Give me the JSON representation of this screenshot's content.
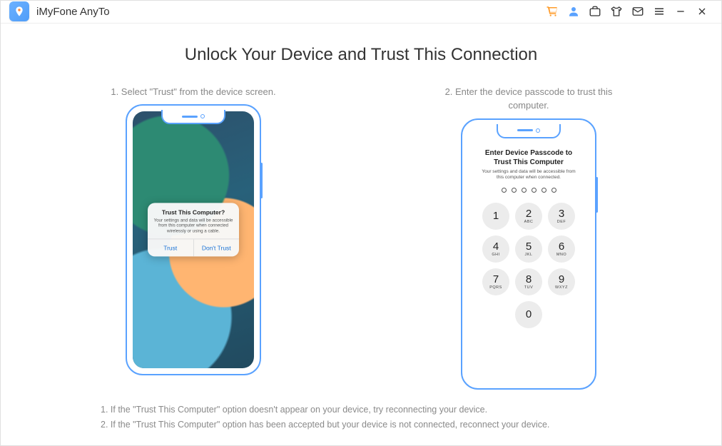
{
  "app": {
    "title": "iMyFone AnyTo"
  },
  "main": {
    "title": "Unlock Your Device and Trust This Connection",
    "steps": {
      "left": {
        "caption": "1. Select \"Trust\" from the device screen."
      },
      "right": {
        "caption": "2. Enter the device passcode to trust this computer."
      }
    }
  },
  "trust_dialog": {
    "title": "Trust This Computer?",
    "body": "Your settings and data will be accessible from this computer when connected wirelessly or using a cable.",
    "trust": "Trust",
    "dont_trust": "Don't Trust"
  },
  "passcode": {
    "title": "Enter Device Passcode to Trust This Computer",
    "sub": "Your settings and data will be accessible from this computer when connected.",
    "keys": [
      {
        "n": "1",
        "l": ""
      },
      {
        "n": "2",
        "l": "ABC"
      },
      {
        "n": "3",
        "l": "DEF"
      },
      {
        "n": "4",
        "l": "GHI"
      },
      {
        "n": "5",
        "l": "JKL"
      },
      {
        "n": "6",
        "l": "MNO"
      },
      {
        "n": "7",
        "l": "PQRS"
      },
      {
        "n": "8",
        "l": "TUV"
      },
      {
        "n": "9",
        "l": "WXYZ"
      },
      {
        "n": "0",
        "l": ""
      }
    ]
  },
  "notes": {
    "n1": "1. If the \"Trust This Computer\" option doesn't appear on your device, try reconnecting your device.",
    "n2": "2. If the \"Trust This Computer\" option has been accepted but your device is not connected, reconnect your device."
  }
}
